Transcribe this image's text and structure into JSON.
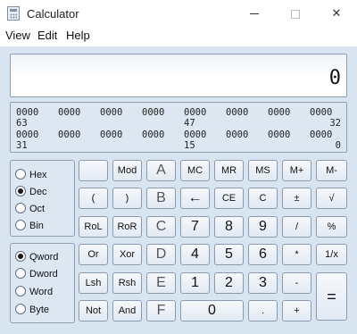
{
  "window": {
    "title": "Calculator",
    "icon": "calculator-icon",
    "controls": [
      "minimize",
      "maximize",
      "close"
    ]
  },
  "menu": [
    "View",
    "Edit",
    "Help"
  ],
  "display": {
    "value": "0"
  },
  "bits": {
    "row1": [
      "0000",
      "0000",
      "0000",
      "0000",
      "0000",
      "0000",
      "0000",
      "0000"
    ],
    "row1_labels": [
      "63",
      "47",
      "32"
    ],
    "row2": [
      "0000",
      "0000",
      "0000",
      "0000",
      "0000",
      "0000",
      "0000",
      "0000"
    ],
    "row2_labels": [
      "31",
      "15",
      "0"
    ]
  },
  "base": {
    "options": [
      "Hex",
      "Dec",
      "Oct",
      "Bin"
    ],
    "selected": "Dec"
  },
  "word": {
    "options": [
      "Qword",
      "Dword",
      "Word",
      "Byte"
    ],
    "selected": "Qword"
  },
  "keys": {
    "blank": "",
    "mod": "Mod",
    "A": "A",
    "MC": "MC",
    "MR": "MR",
    "MS": "MS",
    "Mplus": "M+",
    "Mminus": "M-",
    "lparen": "(",
    "rparen": ")",
    "B": "B",
    "back": "←",
    "CE": "CE",
    "C": "C",
    "plusminus": "±",
    "sqrt": "√",
    "RoL": "RoL",
    "RoR": "RoR",
    "Cx": "C",
    "n7": "7",
    "n8": "8",
    "n9": "9",
    "div": "/",
    "pct": "%",
    "Or": "Or",
    "Xor": "Xor",
    "D": "D",
    "n4": "4",
    "n5": "5",
    "n6": "6",
    "mul": "*",
    "recip": "1/x",
    "Lsh": "Lsh",
    "Rsh": "Rsh",
    "E": "E",
    "n1": "1",
    "n2": "2",
    "n3": "3",
    "sub": "-",
    "eq": "=",
    "Not": "Not",
    "And": "And",
    "F": "F",
    "n0": "0",
    "dot": ".",
    "add": "+"
  }
}
